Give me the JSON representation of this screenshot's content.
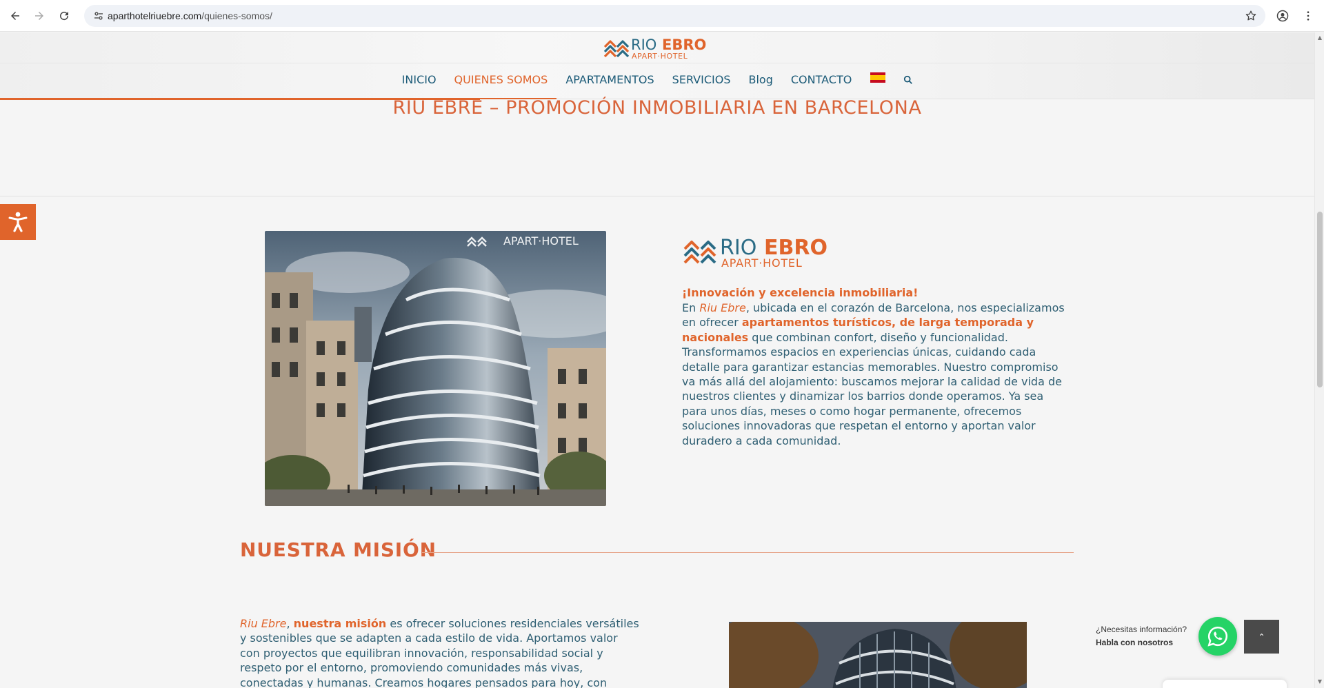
{
  "browser": {
    "url_domain": "aparthotelriuebre.com",
    "url_path": "/quienes-somos/"
  },
  "header": {
    "logo": {
      "word1": "RIO",
      "word2": "EBRO",
      "sub": "APART·HOTEL"
    },
    "menu": [
      {
        "label": "INICIO",
        "active": false
      },
      {
        "label": "QUIENES SOMOS",
        "active": true
      },
      {
        "label": "APARTAMENTOS",
        "active": false
      },
      {
        "label": "SERVICIOS",
        "active": false
      },
      {
        "label": "Blog",
        "active": false
      },
      {
        "label": "CONTACTO",
        "active": false
      }
    ],
    "language_flag": "spain-flag-icon",
    "search_icon": "search-icon"
  },
  "title": "RIU EBRE – PROMOCIÓN INMOBILIARIA EN BARCELONA",
  "about": {
    "image_watermark": "APART·HOTEL",
    "logo": {
      "word1": "RIO",
      "word2": "EBRO",
      "sub": "APART·HOTEL"
    },
    "heading": "¡Innovación y excelencia inmobiliaria!",
    "p_start": "En ",
    "p_brand": "Riu Ebre",
    "p_mid": ", ubicada en el corazón de Barcelona, nos especializamos en ofrecer ",
    "p_highlight": "apartamentos turísticos, de larga temporada y nacionales",
    "p_end": " que combinan confort, diseño y funcionalidad. Transformamos espacios en experiencias únicas, cuidando cada detalle para garantizar estancias memorables. Nuestro compromiso va más allá del alojamiento: buscamos mejorar la calidad de vida de nuestros clientes y dinamizar los barrios donde operamos. Ya sea para unos días, meses o como hogar permanente, ofrecemos soluciones innovadoras que respetan el entorno y aportan valor duradero a cada comunidad."
  },
  "mision": {
    "title": "NUESTRA MISIÓN",
    "brand": "Riu Ebre",
    "sep": ", ",
    "highlight": "nuestra misión",
    "text": " es ofrecer soluciones residenciales versátiles y sostenibles que se adapten a cada estilo de vida. Aportamos valor con proyectos que equilibran innovación, responsabilidad social y respeto por el entorno, promoviendo comunidades más vivas, conectadas y humanas. Creamos hogares pensados para hoy, con visión de futuro."
  },
  "whatsapp": {
    "question": "¿Necesitas información?",
    "cta": "Habla con nosotros"
  },
  "colors": {
    "accent": "#e0642b",
    "navy": "#1b5a77",
    "body_text": "#2f5f73",
    "whatsapp": "#25d366"
  }
}
